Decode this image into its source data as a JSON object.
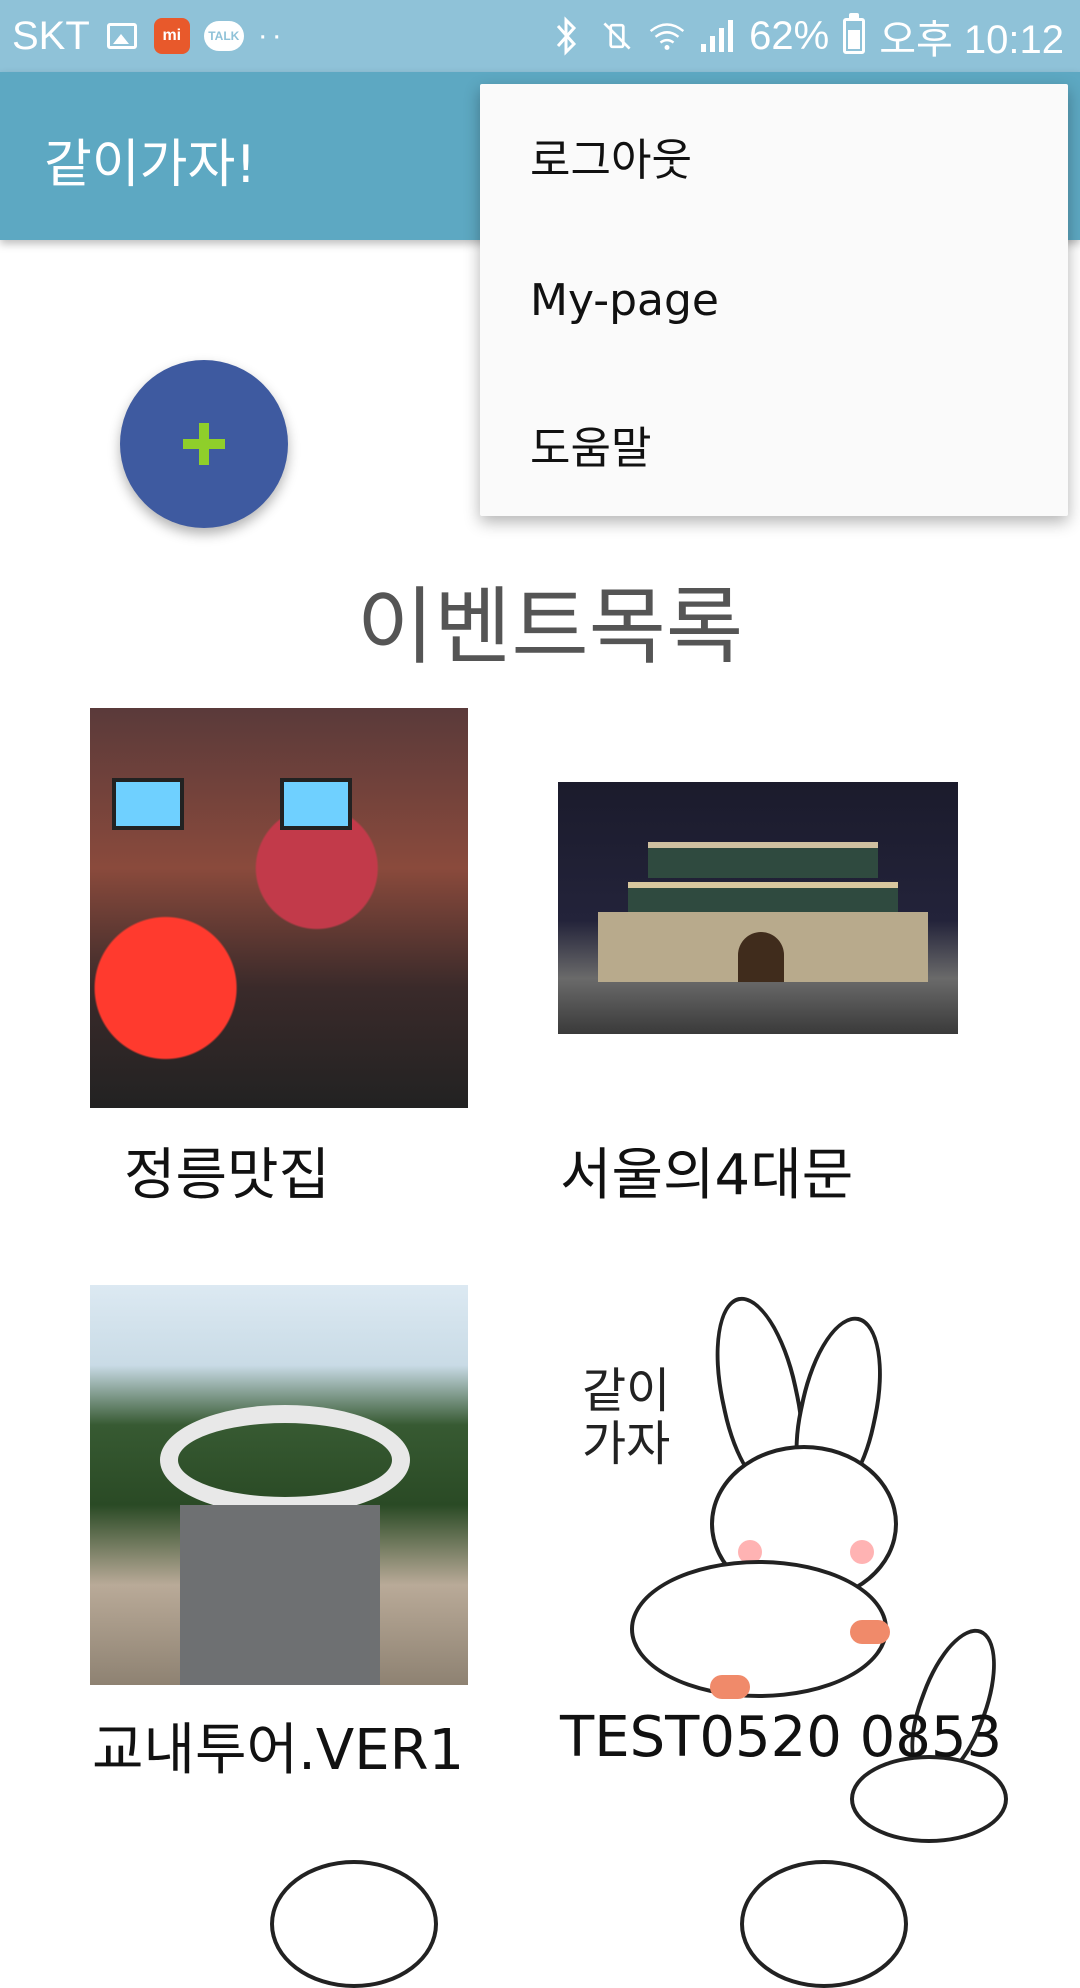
{
  "status_bar": {
    "carrier": "SKT",
    "mi_badge": "mi",
    "talk_badge": "TALK",
    "dots": "··",
    "battery_percent": "62%",
    "time": "오후 10:12"
  },
  "app_bar": {
    "title": "같이가자!"
  },
  "overflow_menu": {
    "items": [
      {
        "label": "로그아웃"
      },
      {
        "label": "My-page"
      },
      {
        "label": "도움말"
      }
    ]
  },
  "main": {
    "section_title": "이벤트목록",
    "events": [
      {
        "title": "정릉맛집"
      },
      {
        "title": "서울의4대문"
      },
      {
        "title": "교내투어.VER1"
      },
      {
        "title": "TEST0520 0853"
      }
    ],
    "sticker_text": "같이\n가자"
  },
  "colors": {
    "status_bar": "#8fc2d8",
    "app_bar": "#5da8c2",
    "fab": "#3e5aa0",
    "fab_plus": "#8fcf2a"
  }
}
